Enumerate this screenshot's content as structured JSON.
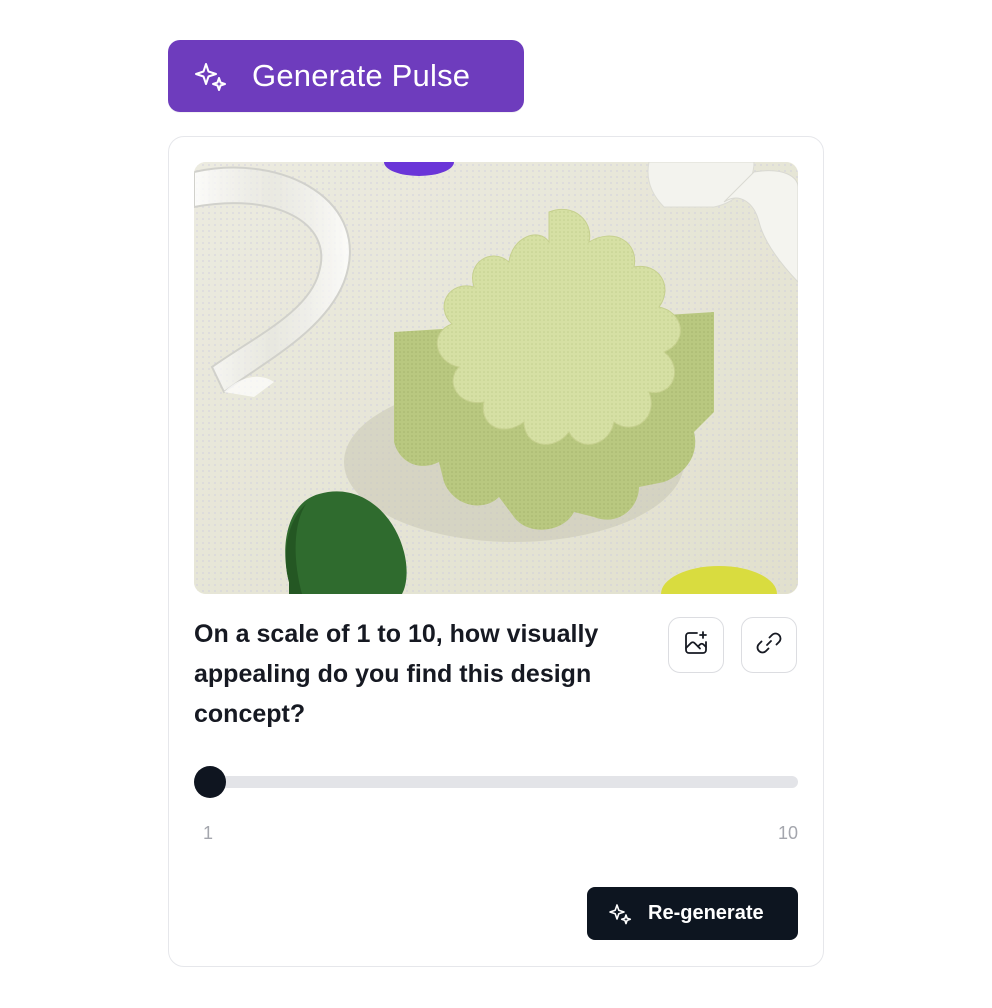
{
  "generate_button": {
    "label": "Generate Pulse",
    "icon": "sparkles-icon",
    "color": "#6e3cbd"
  },
  "card": {
    "image": {
      "alt": "green scalloped flower-shaped block on a dotted surface"
    },
    "question": "On a scale of 1 to 10, how visually appealing do you find this design concept?",
    "actions": [
      {
        "icon": "image-add-icon"
      },
      {
        "icon": "link-icon"
      }
    ],
    "slider": {
      "min_label": "1",
      "max_label": "10",
      "min": 1,
      "max": 10,
      "value": 1
    },
    "regenerate_button": {
      "label": "Re-generate",
      "icon": "sparkles-icon",
      "color": "#0d1520"
    }
  }
}
